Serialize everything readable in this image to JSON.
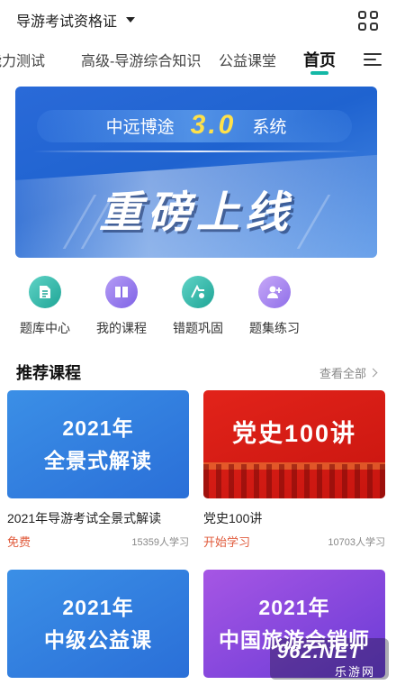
{
  "header": {
    "certificate_select": "导游考试资格证",
    "grid_icon": "grid-apps-icon"
  },
  "tabs": [
    {
      "label": "能力测试",
      "active": false
    },
    {
      "label": "高级-导游综合知识",
      "active": false
    },
    {
      "label": "公益课堂",
      "active": false
    },
    {
      "label": "首页",
      "active": true
    }
  ],
  "tab_accent_color": "#14b8a6",
  "menu_icon": "hamburger-menu-icon",
  "banner": {
    "brand": "中远博途",
    "version": "3.0",
    "suffix": "系统",
    "headline": "重磅上线"
  },
  "quick_menu": [
    {
      "label": "题库中心",
      "icon": "question-bank-icon"
    },
    {
      "label": "我的课程",
      "icon": "book-icon"
    },
    {
      "label": "错题巩固",
      "icon": "wrong-questions-icon"
    },
    {
      "label": "题集练习",
      "icon": "practice-set-icon"
    }
  ],
  "recommended": {
    "title": "推荐课程",
    "view_all": "查看全部"
  },
  "courses": [
    {
      "thumb_line1": "2021年",
      "thumb_line2": "全景式解读",
      "title": "2021年导游考试全景式解读",
      "tag": "免费",
      "learners": "15359人学习"
    },
    {
      "thumb_line1": "党史100讲",
      "thumb_line2": "",
      "title": "党史100讲",
      "tag": "开始学习",
      "learners": "10703人学习"
    },
    {
      "thumb_line1": "2021年",
      "thumb_line2": "中级公益课"
    },
    {
      "thumb_line1": "2021年",
      "thumb_line2": "中国旅游会销师"
    }
  ],
  "watermark": {
    "logo": "962.NET",
    "sub": "乐游网"
  }
}
